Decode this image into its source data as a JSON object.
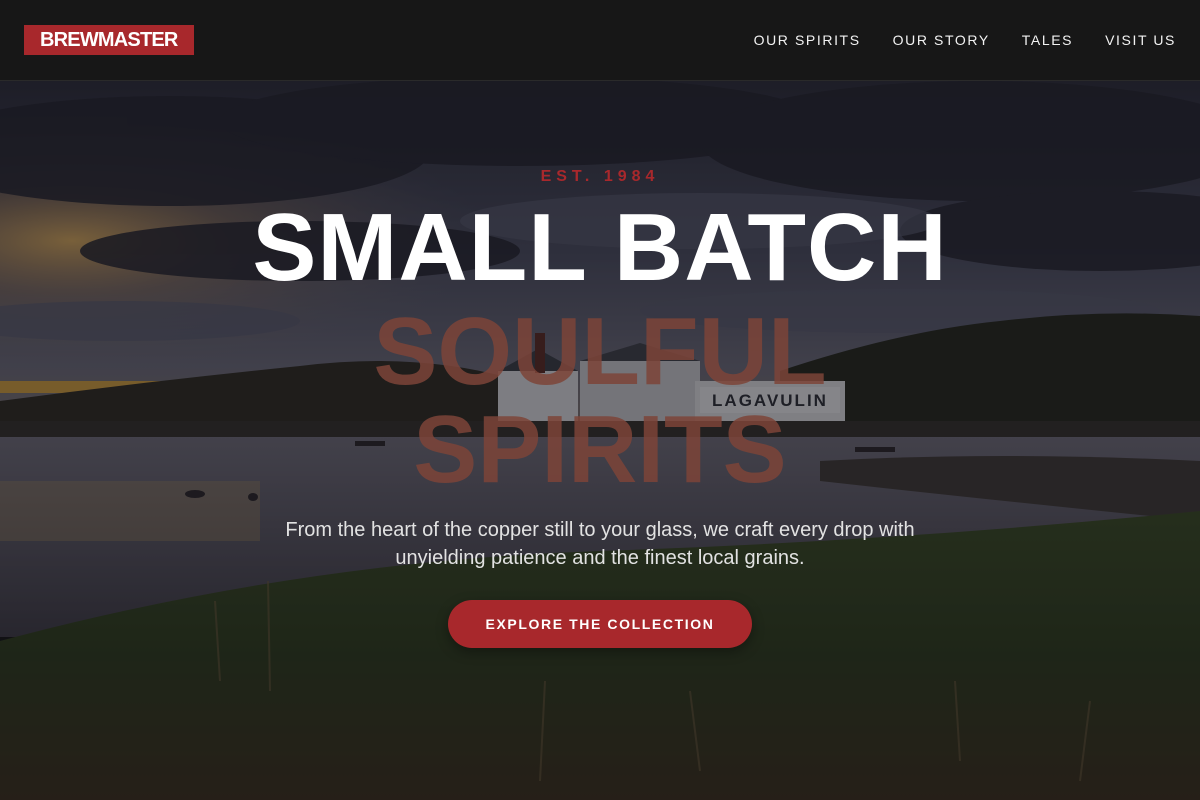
{
  "header": {
    "logo_text": "BREWMASTER",
    "nav": [
      {
        "label": "OUR SPIRITS"
      },
      {
        "label": "OUR STORY"
      },
      {
        "label": "TALES"
      },
      {
        "label": "VISIT US"
      }
    ]
  },
  "hero": {
    "eyebrow": "EST. 1984",
    "headline": "SMALL BATCH",
    "subheadline": "SOULFUL SPIRITS",
    "tagline": "From the heart of the copper still to your glass, we craft every drop with unyielding patience and the finest local grains.",
    "cta_label": "EXPLORE THE COLLECTION",
    "photo": {
      "subject": "distillery-on-loch-at-dusk",
      "sign_text": "LAGAVULIN"
    }
  },
  "colors": {
    "accent": "#a8282c",
    "nav_bg": "#171717",
    "subheadline": "#7d4438"
  }
}
